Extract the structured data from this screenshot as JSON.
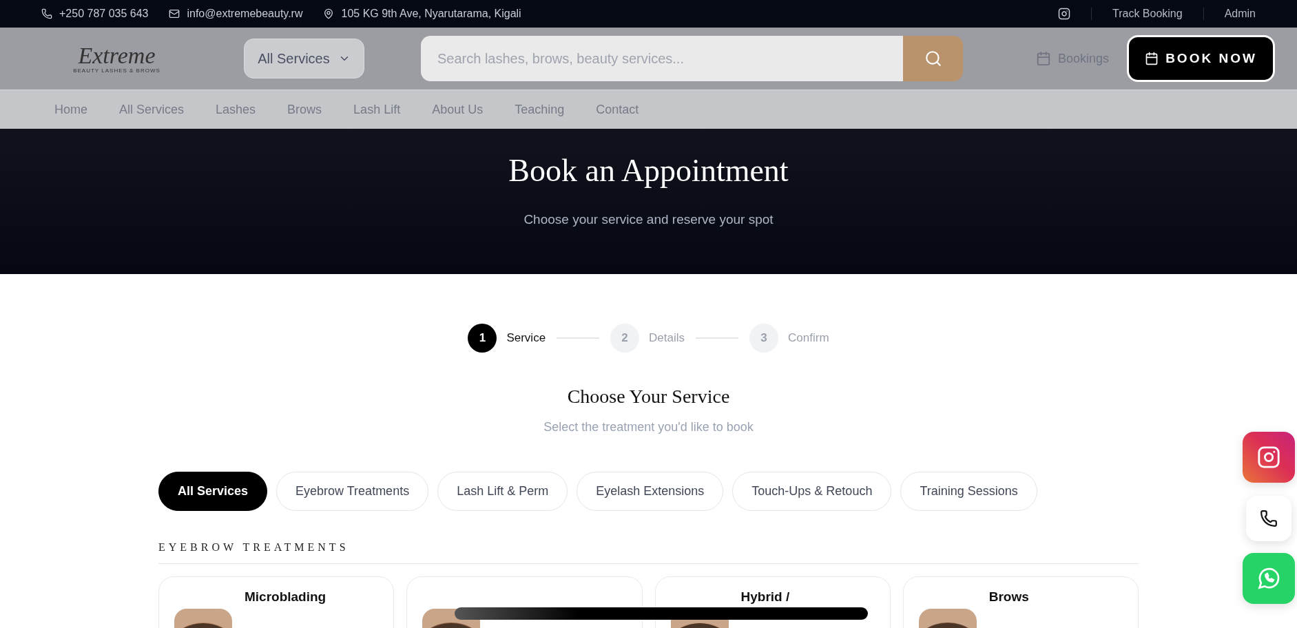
{
  "topbar": {
    "phone": "+250 787 035 643",
    "email": "info@extremebeauty.rw",
    "address": "105 KG 9th Ave, Nyarutarama, Kigali",
    "links": [
      "Track Booking",
      "Admin"
    ]
  },
  "header": {
    "logo": {
      "name": "Extreme",
      "tagline": "BEAUTY LASHES & BROWS"
    },
    "category_dropdown": "All Services",
    "search": {
      "placeholder": "Search lashes, brows, beauty services..."
    },
    "bookings_link": "Bookings",
    "book_button": "BOOK NOW"
  },
  "nav": [
    {
      "label": "Home"
    },
    {
      "label": "All Services"
    },
    {
      "label": "Lashes"
    },
    {
      "label": "Brows"
    },
    {
      "label": "Lash Lift"
    },
    {
      "label": "About Us"
    },
    {
      "label": "Teaching"
    },
    {
      "label": "Contact"
    }
  ],
  "hero": {
    "title": "Book an Appointment",
    "subtitle": "Choose your service and reserve your spot"
  },
  "steps": [
    {
      "number": "1",
      "label": "Service",
      "selected": true
    },
    {
      "number": "2",
      "label": "Details",
      "selected": false
    },
    {
      "number": "3",
      "label": "Confirm",
      "selected": false
    }
  ],
  "section": {
    "title": "Choose Your Service",
    "subtitle": "Select the treatment you'd like to book"
  },
  "filters": [
    {
      "label": "All Services",
      "selected": true
    },
    {
      "label": "Eyebrow Treatments",
      "selected": false
    },
    {
      "label": "Lash Lift & Perm",
      "selected": false
    },
    {
      "label": "Eyelash Extensions",
      "selected": false
    },
    {
      "label": "Touch-Ups & Retouch",
      "selected": false
    },
    {
      "label": "Training Sessions",
      "selected": false
    }
  ],
  "category_heading": "EYEBROW TREATMENTS",
  "cards": [
    {
      "kind": "picture",
      "title": "Microblading"
    },
    {
      "kind": "picture"
    },
    {
      "kind": "picture",
      "title": "Hybrid /"
    },
    {
      "kind": "picture",
      "title": "Brows"
    }
  ]
}
